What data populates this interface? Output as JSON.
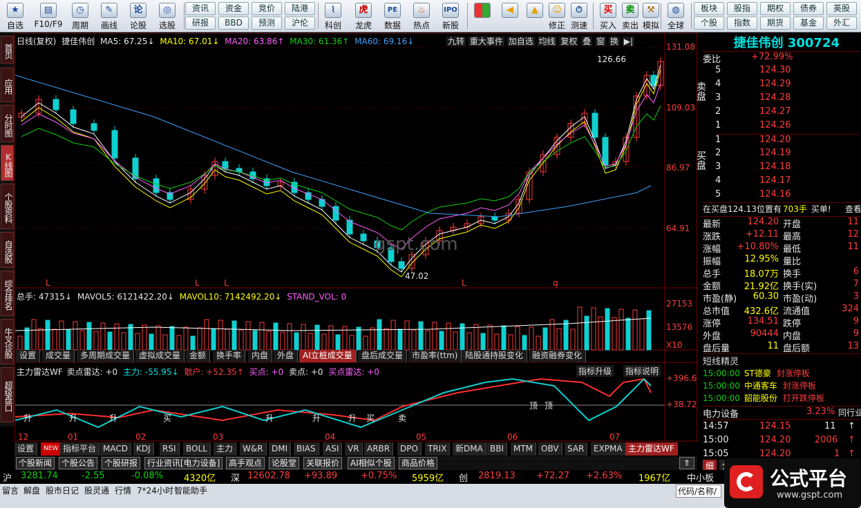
{
  "toolbar": {
    "items": [
      {
        "label": "自选",
        "icon": "star-icon"
      },
      {
        "label": "F10/F9",
        "icon": "info-panel-icon"
      },
      {
        "label": "周期",
        "icon": "clock-icon"
      },
      {
        "label": "画线",
        "icon": "pencil-icon"
      },
      {
        "label": "论股",
        "icon": "forum-icon"
      },
      {
        "label": "选股",
        "icon": "radar-icon"
      }
    ],
    "buttons_grid": [
      "资讯",
      "资金",
      "竞价",
      "陆港",
      "研报",
      "BBD",
      "预测",
      "沪伦"
    ],
    "items2": [
      {
        "label": "科创",
        "icon": "chart-icon"
      },
      {
        "label": "龙虎",
        "icon": "tiger-icon"
      },
      {
        "label": "数据",
        "icon": "pe-icon"
      },
      {
        "label": "热点",
        "icon": "flame-icon"
      },
      {
        "label": "新股",
        "icon": "ipo-icon"
      }
    ],
    "items3": [
      {
        "label": "",
        "icon": "grid-icon"
      },
      {
        "label": "",
        "icon": "back-arrow-icon"
      },
      {
        "label": "",
        "icon": "up-arrow-icon"
      },
      {
        "label": "修正",
        "icon": "smile-icon"
      },
      {
        "label": "测速",
        "icon": "stopwatch-icon"
      },
      {
        "label": "买入",
        "icon": "buy-icon"
      },
      {
        "label": "卖出",
        "icon": "sell-icon"
      },
      {
        "label": "模拟",
        "icon": "hammer-icon"
      },
      {
        "label": "全球",
        "icon": "globe-icon"
      }
    ],
    "right_grid": [
      "板块",
      "股指",
      "期权",
      "债券",
      "英股",
      "个股",
      "指数",
      "期货",
      "基金",
      "外汇"
    ]
  },
  "left_tabs": [
    "首页",
    "应用",
    "分时图",
    "K线图",
    "个股资料",
    "自选股",
    "综合排名",
    "牛叉诊股",
    "超级盘口"
  ],
  "main_header": {
    "period": "日线(复权)",
    "name": "捷佳伟创",
    "ma5": "MA5: 67.25↓",
    "ma10": "MA10: 67.01↓",
    "ma20": "MA20: 63.86↑",
    "ma30": "MA30: 61.36↑",
    "ma60": "MA60: 69.16↓"
  },
  "main_buttons": [
    "九转",
    "重大事件",
    "加自选",
    "均线",
    "复权",
    "叠",
    "窗",
    "换"
  ],
  "price_axis": [
    "131.08",
    "109.03",
    "86.97",
    "64.91"
  ],
  "annotations": {
    "high": "126.66",
    "low": "47.02",
    "watermark": "gspt.com"
  },
  "chart_markers": [
    "L",
    "L",
    "L",
    "L",
    "q"
  ],
  "volume_header": {
    "total": "总手: 47315↓",
    "mavol5": "MAVOL5: 6121422.20↓",
    "mavol10": "MAVOL10: 7142492.20↓",
    "stand": "STAND_VOL: 0"
  },
  "volume_axis": [
    "27153",
    "13576",
    "X10"
  ],
  "panel2_tabs": [
    "设置",
    "成交量",
    "多周期成交量",
    "虚拟成交量",
    "金额",
    "换手率",
    "内盘",
    "外盘",
    "AI立桩成交量",
    "盘后成交量",
    "市盈率(ttm)",
    "陆股通持股变化",
    "融资融券变化"
  ],
  "indicator_header": {
    "name": "主力雷达WF",
    "sell_radar": "卖点雷达: +0",
    "main": "主力: -55.95↓",
    "retail": "散户: +52.35↑",
    "buy": "买点: +0",
    "sell": "卖点: +0",
    "buy_radar": "买点雷达: +0"
  },
  "indicator_buttons": [
    "指标升级",
    "指标说明"
  ],
  "indicator_axis": [
    "+396.6",
    "+38.72"
  ],
  "indicator_signals": [
    "升",
    "升",
    "升",
    "买",
    "升",
    "升",
    "升",
    "买",
    "卖",
    "顶",
    "顶"
  ],
  "month_axis": [
    "12",
    "01",
    "02",
    "03",
    "04",
    "05",
    "06",
    "07"
  ],
  "bottom_tabs": [
    "设置",
    "NEW",
    "指标平台",
    "MACD",
    "KDJ",
    "RSI",
    "BOLL",
    "主力",
    "W&R",
    "DMI",
    "BIAS",
    "ASI",
    "VR",
    "ARBR",
    "DPO",
    "TRIX",
    "新DMA",
    "BBI",
    "MTM",
    "OBV",
    "SAR",
    "EXPMA",
    "主力雷达WF"
  ],
  "news_bar": [
    "个股新闻",
    "个股公告",
    "个股研报",
    "行业资讯[电力设备]",
    "高手观点",
    "论股堂",
    "关联报价",
    "AI相似个股",
    "商品价格"
  ],
  "quote": {
    "title": "捷佳伟创 300724",
    "weibi_label": "委比",
    "weibi": "+72.99%",
    "sell_label": "卖盘",
    "buy_label": "买盘",
    "asks": [
      {
        "lv": "5",
        "p": "124.30"
      },
      {
        "lv": "4",
        "p": "124.29"
      },
      {
        "lv": "3",
        "p": "124.28"
      },
      {
        "lv": "2",
        "p": "124.27"
      },
      {
        "lv": "1",
        "p": "124.26"
      }
    ],
    "bids": [
      {
        "lv": "1",
        "p": "124.20"
      },
      {
        "lv": "2",
        "p": "124.19"
      },
      {
        "lv": "3",
        "p": "124.18"
      },
      {
        "lv": "4",
        "p": "124.17"
      },
      {
        "lv": "5",
        "p": "124.16"
      }
    ],
    "zaimai": "在买盘124.13位置有",
    "zaimai_qty": "703手",
    "zaimai_tag": "买单!",
    "zaimai_btn": "查看",
    "stats": [
      {
        "l1": "最新",
        "v1": "124.20",
        "l2": "开盘",
        "v2": "11"
      },
      {
        "l1": "涨跌",
        "v1": "+12.11",
        "l2": "最高",
        "v2": "12"
      },
      {
        "l1": "涨幅",
        "v1": "+10.80%",
        "l2": "最低",
        "v2": "11"
      },
      {
        "l1": "振幅",
        "v1": "12.95%",
        "l2": "量比",
        "v2": ""
      },
      {
        "l1": "总手",
        "v1": "18.07万",
        "l2": "换手",
        "v2": "6"
      },
      {
        "l1": "金额",
        "v1": "21.92亿",
        "l2": "换手(实)",
        "v2": "7"
      },
      {
        "l1": "市盈(静)",
        "v1": "60.30",
        "l2": "市盈(动)",
        "v2": "3"
      },
      {
        "l1": "总市值",
        "v1": "432.6亿",
        "l2": "流通值",
        "v2": "324"
      },
      {
        "l1": "涨停",
        "v1": "134.51",
        "l2": "跌停",
        "v2": "9"
      },
      {
        "l1": "外盘",
        "v1": "90444",
        "l2": "内盘",
        "v2": "9"
      },
      {
        "l1": "盘后量",
        "v1": "11",
        "l2": "盘后额",
        "v2": "13"
      }
    ],
    "sprite_title": "短线精灵",
    "sprites": [
      {
        "t": "15:00:00",
        "n": "ST德豪",
        "e": "封涨停板"
      },
      {
        "t": "15:00:00",
        "n": "中通客车",
        "e": "封涨停板"
      },
      {
        "t": "15:00:00",
        "n": "韶能股份",
        "e": "打开跌停板"
      }
    ],
    "sector": "电力设备",
    "sector_chg": "3.23%",
    "sector_btn": "同行业",
    "ticks": [
      {
        "t": "14:57",
        "p": "124.15",
        "v": "11",
        "d": "↑"
      },
      {
        "t": "15:00",
        "p": "124.20",
        "v": "2006",
        "d": "↑"
      },
      {
        "t": "15:05",
        "p": "124.20",
        "v": "1",
        "d": "↑"
      }
    ],
    "bottom_tabs": [
      "细",
      "分",
      "笔",
      "价",
      "指",
      "财"
    ]
  },
  "index_bar": {
    "sh_label": "沪",
    "sh": "3281.74",
    "sh_chg": "-2.55",
    "sh_pct": "-0.08%",
    "sh_amt": "4320亿",
    "sz_label": "深",
    "sz": "12602.78",
    "sz_chg": "+93.89",
    "sz_pct": "+0.75%",
    "sz_amt": "5959亿",
    "cy_label": "创",
    "cy": "2819.13",
    "cy_chg": "+72.27",
    "cy_pct": "+2.63%",
    "cy_amt": "1967亿",
    "extra": "中小板"
  },
  "status_bar": [
    "留言",
    "解盘",
    "股市日记",
    "股灵通",
    "行情",
    "7*24小时",
    "智能助手"
  ],
  "status_search": "代码/名称/",
  "logo": {
    "text": "公式平台",
    "url": "www.gspt.com"
  },
  "colors": {
    "up": "#ff3c3c",
    "down": "#10d0d0",
    "ma5": "#ffffff",
    "ma10": "#ffff00",
    "ma20": "#ff60ff",
    "ma30": "#10d010",
    "ma60": "#40a0ff"
  }
}
